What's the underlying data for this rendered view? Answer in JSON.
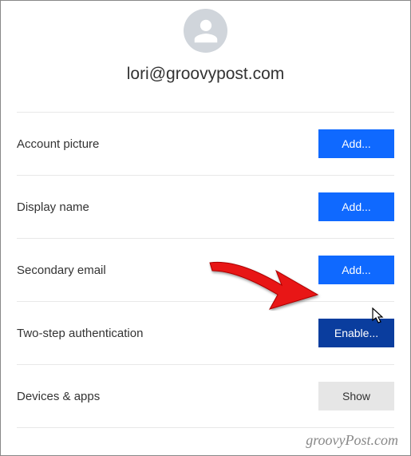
{
  "account": {
    "email": "lori@groovypost.com"
  },
  "settings": [
    {
      "label": "Account picture",
      "button": "Add...",
      "style": "primary"
    },
    {
      "label": "Display name",
      "button": "Add...",
      "style": "primary"
    },
    {
      "label": "Secondary email",
      "button": "Add...",
      "style": "primary"
    },
    {
      "label": "Two-step authentication",
      "button": "Enable...",
      "style": "primary dark"
    },
    {
      "label": "Devices & apps",
      "button": "Show",
      "style": "secondary"
    }
  ],
  "watermark": "groovyPost.com"
}
